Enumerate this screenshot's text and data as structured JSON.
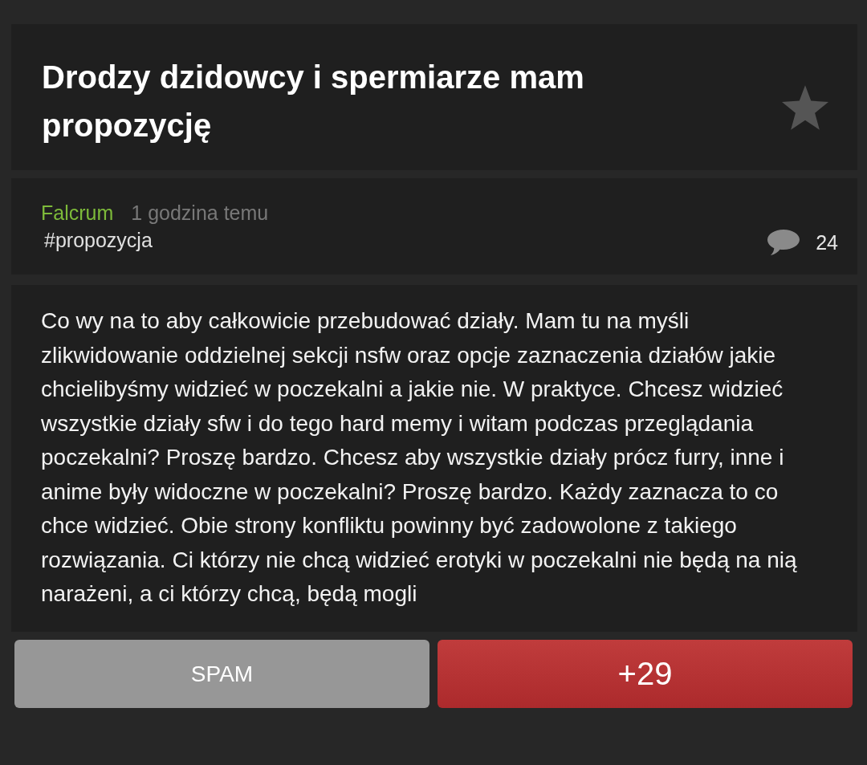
{
  "post": {
    "title": "Drodzy dzidowcy i spermiarze mam propozycję",
    "starred": false
  },
  "meta": {
    "author": "Falcrum",
    "time": "1 godzina temu",
    "tag": "#propozycja",
    "comments": "24"
  },
  "body": "Co wy na to aby całkowicie przebudować działy. Mam tu na myśli zlikwidowanie oddzielnej sekcji nsfw oraz opcje zaznaczenia działów jakie chcielibyśmy widzieć w poczekalni a jakie nie. W praktyce. Chcesz widzieć wszystkie działy sfw i do tego hard memy i witam podczas przeglądania poczekalni? Proszę bardzo. Chcesz aby wszystkie działy prócz furry, inne i anime były widoczne w poczekalni? Proszę bardzo. Każdy zaznacza to co chce widzieć. Obie strony konfliktu powinny być zadowolone z takiego rozwiązania. Ci którzy nie chcą widzieć erotyki w poczekalni nie będą na nią narażeni, a ci którzy chcą, będą mogli",
  "buttons": [
    {
      "kind": "spam",
      "label": "SPAM"
    },
    {
      "kind": "upvote",
      "label": "+29"
    }
  ]
}
